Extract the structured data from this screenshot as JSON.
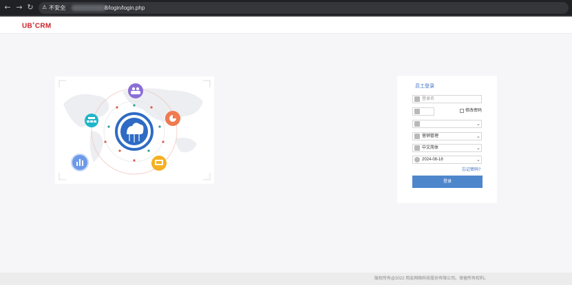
{
  "browser": {
    "security_warning": "不安全",
    "url_visible": "8/login/login.php"
  },
  "header": {
    "logo_main": "UB",
    "logo_plus": "+",
    "logo_tail": "CRM",
    "brand_color": "#c8222a"
  },
  "login": {
    "title": "员工登录",
    "username_placeholder": "登录名",
    "password_value": "",
    "change_password_label": "修改密码",
    "company_value": "",
    "module_value": "营销管理",
    "language_value": "中文简体",
    "date_value": "2024-08-18",
    "forgot_password": "忘记密码?",
    "submit_label": "登录",
    "accent_color": "#4e86cc"
  },
  "footer": {
    "copyright": "版权所有@2022 用友网络科技股份有限公司。保留所有权利。"
  }
}
